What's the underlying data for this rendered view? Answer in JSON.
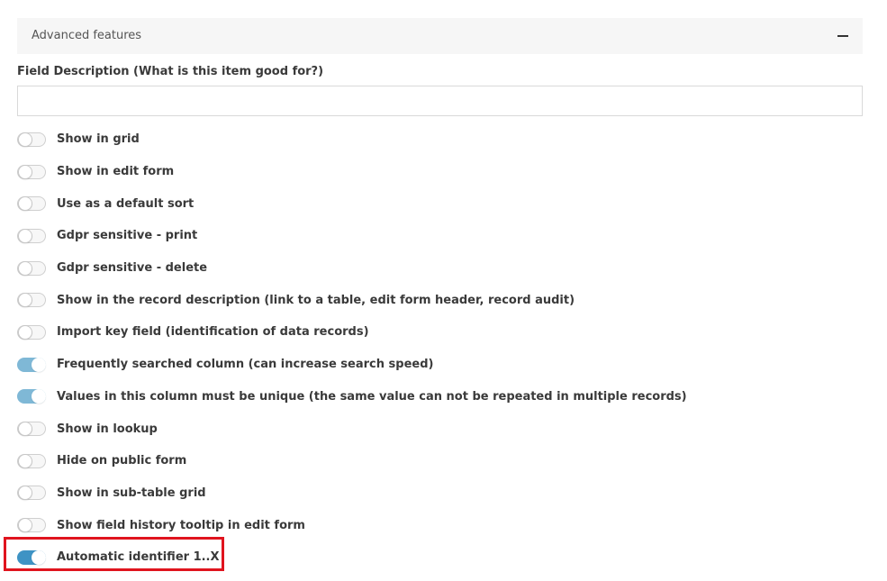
{
  "panel": {
    "title": "Advanced features",
    "collapse_icon": "minus-icon"
  },
  "description_field": {
    "label": "Field Description (What is this item good for?)",
    "value": "",
    "placeholder": ""
  },
  "toggles": [
    {
      "label": "Show in grid",
      "checked": false
    },
    {
      "label": "Show in edit form",
      "checked": false
    },
    {
      "label": "Use as a default sort",
      "checked": false
    },
    {
      "label": "Gdpr sensitive - print",
      "checked": false
    },
    {
      "label": "Gdpr sensitive - delete",
      "checked": false
    },
    {
      "label": "Show in the record description (link to a table, edit form header, record audit)",
      "checked": false
    },
    {
      "label": "Import key field (identification of data records)",
      "checked": false
    },
    {
      "label": "Frequently searched column (can increase search speed)",
      "checked": true
    },
    {
      "label": "Values in this column must be unique (the same value can not be repeated in multiple records)",
      "checked": true
    },
    {
      "label": "Show in lookup",
      "checked": false
    },
    {
      "label": "Hide on public form",
      "checked": false
    },
    {
      "label": "Show in sub-table grid",
      "checked": false
    },
    {
      "label": "Show field history tooltip in edit form",
      "checked": false
    },
    {
      "label": "Automatic identifier 1..X",
      "checked": true,
      "highlighted": true
    }
  ],
  "colors": {
    "toggle_on_light": "#7fb8d6",
    "toggle_on_strong": "#3e93c4",
    "highlight_border": "#e0141e",
    "header_bg": "#f6f6f6"
  }
}
